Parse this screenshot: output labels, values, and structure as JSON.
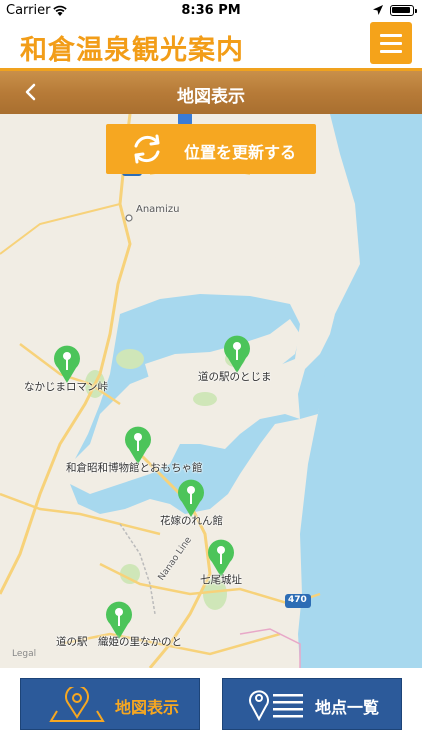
{
  "status_bar": {
    "carrier": "Carrier",
    "time": "8:36 PM"
  },
  "header": {
    "title": "和倉温泉観光案内",
    "menu_icon": "hamburger-menu-icon",
    "accent_color": "#f29d18"
  },
  "title_bar": {
    "back_icon": "chevron-left-icon",
    "title": "地図表示"
  },
  "map": {
    "update_button": {
      "label": "位置を更新する",
      "icon": "refresh-icon"
    },
    "place_labels": [
      "Anamizu",
      "Nanao Line",
      "470"
    ],
    "legal": "Legal",
    "pins": [
      {
        "label": "なかじまロマン峠"
      },
      {
        "label": "道の駅のとじま"
      },
      {
        "label": "和倉昭和博物館とおもちゃ館"
      },
      {
        "label": "花嫁のれん館"
      },
      {
        "label": "七尾城址"
      },
      {
        "label": "道の駅　織姫の里なかのと"
      }
    ],
    "pin_color": "#4cc45a"
  },
  "bottom_nav": {
    "map_button": {
      "label": "地図表示",
      "icon": "map-pin-icon"
    },
    "list_button": {
      "label": "地点一覧",
      "icon": "pin-list-icon"
    },
    "button_color": "#2c5a9a",
    "active_color": "#f6a721"
  }
}
